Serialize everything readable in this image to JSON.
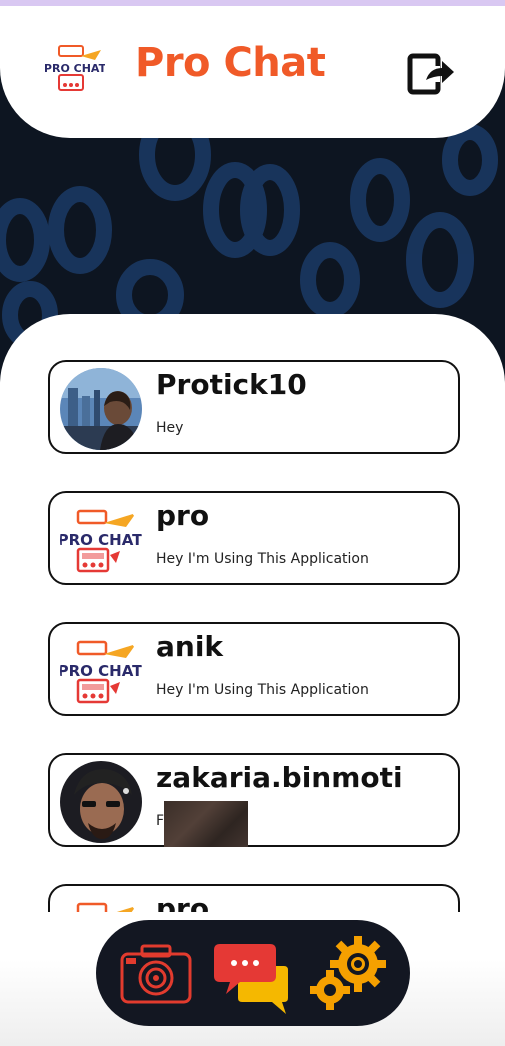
{
  "header": {
    "title": "Pro Chat",
    "logo_text": "PRO CHAT",
    "logout_icon": "logout-icon"
  },
  "chats": [
    {
      "name": "Protick10",
      "status": "Hey",
      "avatar": "photo"
    },
    {
      "name": "pro",
      "status": "Hey I'm Using This Application",
      "avatar": "logo"
    },
    {
      "name": "anik",
      "status": "Hey I'm Using This Application",
      "avatar": "logo"
    },
    {
      "name": "zakaria.binmoti",
      "status": "F      h",
      "avatar": "photo"
    },
    {
      "name": "pro",
      "status": "",
      "avatar": "logo"
    }
  ],
  "nav": {
    "items": [
      "camera-icon",
      "chat-icon",
      "settings-icon"
    ]
  },
  "colors": {
    "accent": "#f05a28",
    "dark": "#0d1521",
    "nav_bg": "#131722",
    "pattern": "#1b3a66",
    "camera": "#e23b2e",
    "chat_red": "#e53935",
    "chat_yellow": "#f5b800",
    "gear": "#f5a000"
  }
}
